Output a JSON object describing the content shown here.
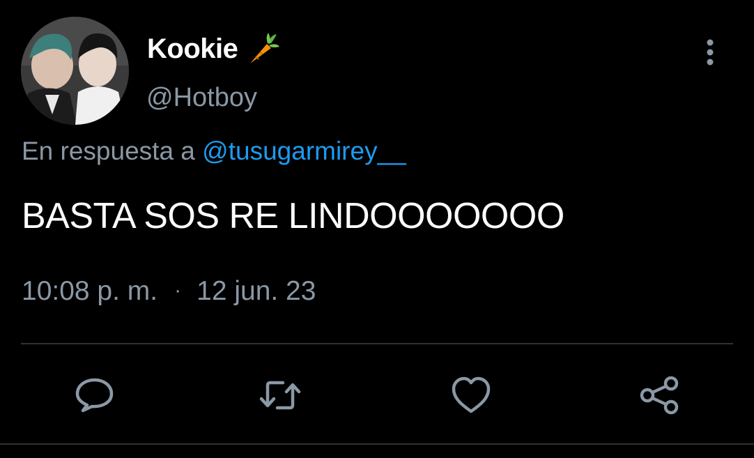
{
  "author": {
    "display_name": "Kookie",
    "handle": "@Hotboy",
    "name_emoji_icon": "carrot-icon",
    "avatar_icon": "profile-photo"
  },
  "reply": {
    "prefix": "En respuesta a",
    "mention": "@tusugarmirey__"
  },
  "tweet": {
    "text": "BASTA SOS RE LINDOOOOOOO",
    "time": "10:08 p. m.",
    "separator": "·",
    "date": "12 jun. 23"
  },
  "actions": [
    {
      "icon": "reply-icon"
    },
    {
      "icon": "retweet-icon"
    },
    {
      "icon": "like-icon"
    },
    {
      "icon": "share-icon"
    }
  ],
  "colors": {
    "background": "#000000",
    "text": "#ffffff",
    "secondary_text": "#8b98a5",
    "link": "#1d9bf0",
    "divider": "#2f3336"
  }
}
